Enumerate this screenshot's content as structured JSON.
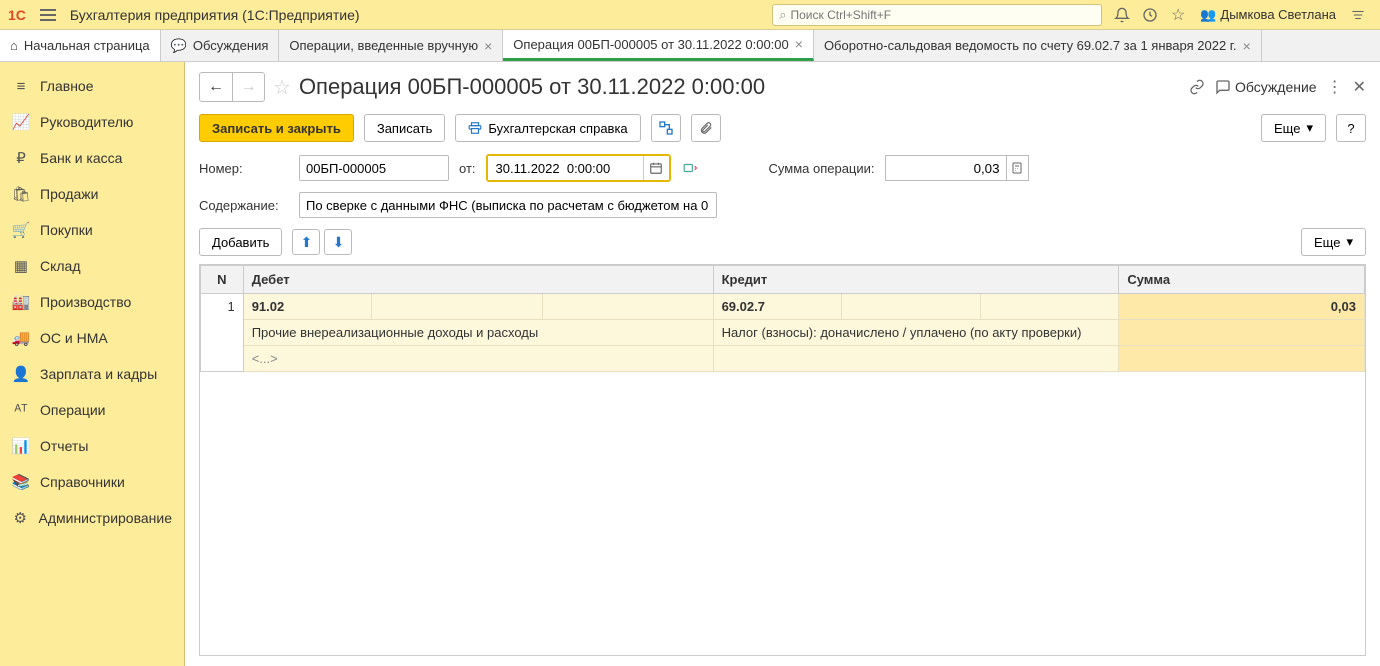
{
  "header": {
    "app_title": "Бухгалтерия предприятия  (1С:Предприятие)",
    "search_placeholder": "Поиск Ctrl+Shift+F",
    "user_name": "Дымкова Светлана"
  },
  "tabs": {
    "home": "Начальная страница",
    "items": [
      {
        "label": "Обсуждения",
        "closable": false
      },
      {
        "label": "Операции, введенные вручную",
        "closable": true
      },
      {
        "label": "Операция 00БП-000005 от 30.11.2022 0:00:00",
        "closable": true,
        "active": true
      },
      {
        "label": "Оборотно-сальдовая ведомость по счету 69.02.7 за 1 января 2022 г.",
        "closable": true
      }
    ]
  },
  "sidebar": {
    "items": [
      {
        "icon": "≡",
        "label": "Главное"
      },
      {
        "icon": "📈",
        "label": "Руководителю"
      },
      {
        "icon": "₽",
        "label": "Банк и касса"
      },
      {
        "icon": "🛍",
        "label": "Продажи"
      },
      {
        "icon": "🛒",
        "label": "Покупки"
      },
      {
        "icon": "▦",
        "label": "Склад"
      },
      {
        "icon": "🏭",
        "label": "Производство"
      },
      {
        "icon": "🚚",
        "label": "ОС и НМА"
      },
      {
        "icon": "👤",
        "label": "Зарплата и кадры"
      },
      {
        "icon": "ᴬᵀ",
        "label": "Операции"
      },
      {
        "icon": "📊",
        "label": "Отчеты"
      },
      {
        "icon": "📚",
        "label": "Справочники"
      },
      {
        "icon": "⚙",
        "label": "Администрирование"
      }
    ]
  },
  "page": {
    "title": "Операция 00БП-000005 от 30.11.2022 0:00:00",
    "discussion": "Обсуждение"
  },
  "toolbar": {
    "save_close": "Записать и закрыть",
    "save": "Записать",
    "print": "Бухгалтерская справка",
    "more": "Еще"
  },
  "form": {
    "number_label": "Номер:",
    "number_value": "00БП-000005",
    "date_label": "от:",
    "date_value": "30.11.2022  0:00:00",
    "amount_label": "Сумма операции:",
    "amount_value": "0,03",
    "content_label": "Содержание:",
    "content_value": "По сверке с данными ФНС (выписка по расчетам с бюджетом на 0",
    "add": "Добавить"
  },
  "columns": {
    "n": "N",
    "debit": "Дебет",
    "credit": "Кредит",
    "sum": "Сумма"
  },
  "rows": [
    {
      "n": "1",
      "debit_account": "91.02",
      "credit_account": "69.02.7",
      "sum": "0,03",
      "debit_desc": "Прочие внереализационные доходы и расходы",
      "credit_desc": "Налог (взносы): доначислено / уплачено (по акту проверки)",
      "extra": "<...>"
    }
  ]
}
